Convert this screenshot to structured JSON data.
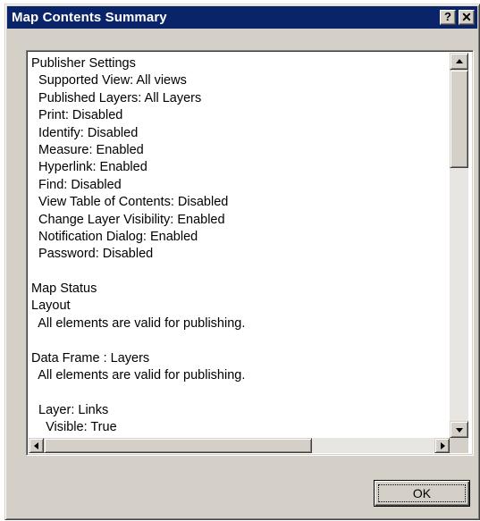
{
  "window": {
    "title": "Map Contents Summary",
    "help_label": "?",
    "close_label": "✕"
  },
  "summary": {
    "lines": [
      "Publisher Settings",
      "  Supported View: All views",
      "  Published Layers: All Layers",
      "  Print: Disabled",
      "  Identify: Disabled",
      "  Measure: Enabled",
      "  Hyperlink: Enabled",
      "  Find: Disabled",
      "  View Table of Contents: Disabled",
      "  Change Layer Visibility: Enabled",
      "  Notification Dialog: Enabled",
      "  Password: Disabled",
      "",
      "Map Status",
      "Layout",
      "  All elements are valid for publishing.",
      "",
      "Data Frame : Layers",
      "  All elements are valid for publishing.",
      "",
      "  Layer: Links",
      "    Visible: True"
    ]
  },
  "buttons": {
    "ok_label": "OK"
  },
  "icons": {
    "help": "help-icon",
    "close": "close-icon",
    "scroll_up": "arrow-up-icon",
    "scroll_down": "arrow-down-icon",
    "scroll_left": "arrow-left-icon",
    "scroll_right": "arrow-right-icon"
  },
  "colors": {
    "title_bar": "#0a246a",
    "dialog_face": "#d4d0c8",
    "listbox_bg": "#ffffff"
  }
}
